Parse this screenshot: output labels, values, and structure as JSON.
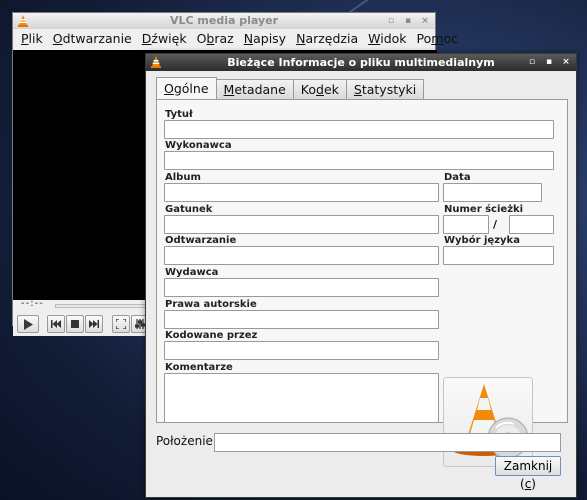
{
  "main_window": {
    "title": "VLC media player",
    "menu": [
      {
        "label": "Plik",
        "mnemonic": "P",
        "rest": "lik"
      },
      {
        "label": "Odtwarzanie",
        "mnemonic": "O",
        "rest": "dtwarzanie"
      },
      {
        "label": "Dźwięk",
        "mnemonic": "D",
        "rest": "źwięk"
      },
      {
        "label": "Obraz",
        "mnemonic": "b",
        "pre": "O",
        "rest": "raz"
      },
      {
        "label": "Napisy",
        "mnemonic": "N",
        "rest": "apisy"
      },
      {
        "label": "Narzędzia",
        "mnemonic": "N",
        "rest": "arzędzia"
      },
      {
        "label": "Widok",
        "mnemonic": "W",
        "rest": "idok"
      },
      {
        "label": "Pomoc",
        "mnemonic": "m",
        "pre": "Po",
        "rest": "oc"
      }
    ],
    "time_display": "--:--",
    "controls": [
      "play-icon",
      "previous-icon",
      "stop-icon",
      "next-icon",
      "fullscreen-icon",
      "extended-settings-icon",
      "playlist-icon"
    ]
  },
  "dialog": {
    "title": "Bieżące Informacje o pliku multimedialnym",
    "tabs": [
      {
        "label": "Ogólne",
        "pre": "",
        "mnemonic": "O",
        "rest": "gólne",
        "active": true
      },
      {
        "label": "Metadane",
        "pre": "",
        "mnemonic": "M",
        "rest": "etadane",
        "active": false
      },
      {
        "label": "Kodek",
        "pre": "Ko",
        "mnemonic": "d",
        "rest": "ek",
        "active": false
      },
      {
        "label": "Statystyki",
        "pre": "",
        "mnemonic": "S",
        "rest": "tatystyki",
        "active": false
      }
    ],
    "fields": {
      "title_label": "Tytuł",
      "artist_label": "Wykonawca",
      "album_label": "Album",
      "date_label": "Data",
      "genre_label": "Gatunek",
      "track_number_label": "Numer ścieżki",
      "track_separator": "/",
      "now_playing_label": "Odtwarzanie",
      "language_label": "Wybór języka",
      "publisher_label": "Wydawca",
      "copyright_label": "Prawa autorskie",
      "encoded_by_label": "Kodowane przez",
      "comments_label": "Komentarze"
    },
    "values": {
      "title": "",
      "artist": "",
      "album": "",
      "date": "",
      "genre": "",
      "track_number": "",
      "track_total": "",
      "now_playing": "",
      "language": "",
      "publisher": "",
      "copyright": "",
      "encoded_by": "",
      "comments": "",
      "location": ""
    },
    "location_label": "Położenie:",
    "close_button": {
      "pre": "Zamknij (",
      "mnemonic": "c",
      "post": ")"
    }
  },
  "colors": {
    "vlc_orange": "#f28a0e",
    "dialog_titlebar": "#3a3a3a",
    "desktop": "#24365e"
  }
}
